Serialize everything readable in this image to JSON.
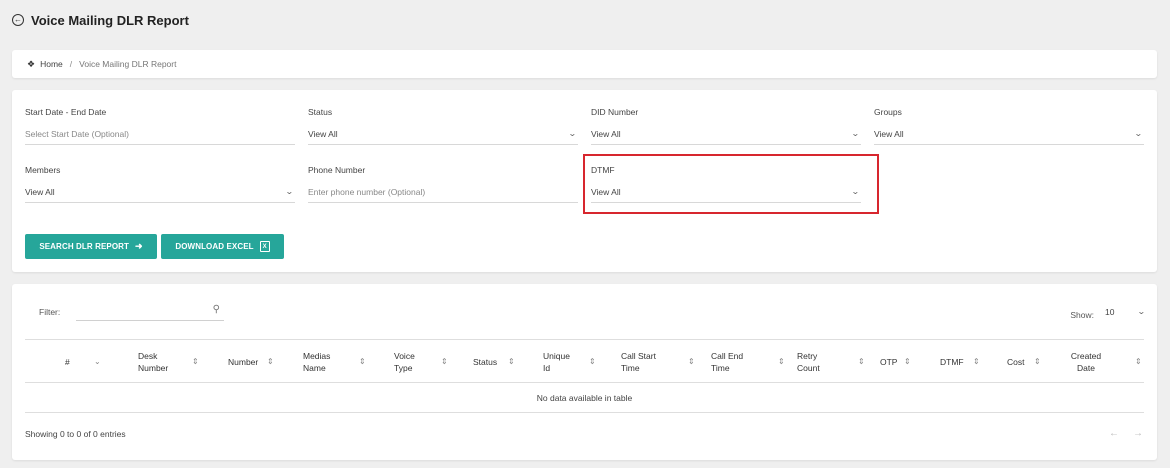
{
  "header": {
    "title": "Voice Mailing DLR Report"
  },
  "breadcrumb": {
    "home": "Home",
    "separator": "/",
    "current": "Voice Mailing DLR Report"
  },
  "filters": {
    "date_range": {
      "label": "Start Date - End Date",
      "placeholder": "Select Start Date (Optional)"
    },
    "status": {
      "label": "Status",
      "value": "View All"
    },
    "did_number": {
      "label": "DID Number",
      "value": "View All"
    },
    "groups": {
      "label": "Groups",
      "value": "View All"
    },
    "members": {
      "label": "Members",
      "value": "View All"
    },
    "phone_number": {
      "label": "Phone Number",
      "placeholder": "Enter phone number (Optional)"
    },
    "dtmf": {
      "label": "DTMF",
      "value": "View All"
    }
  },
  "buttons": {
    "search": "SEARCH DLR REPORT",
    "download": "DOWNLOAD EXCEL"
  },
  "table": {
    "filter_label": "Filter:",
    "show_label": "Show:",
    "page_size": "10",
    "columns": [
      "#",
      "Desk Number",
      "Number",
      "Medias Name",
      "Voice Type",
      "Status",
      "Unique Id",
      "Call Start Time",
      "Call End Time",
      "Retry Count",
      "OTP",
      "DTMF",
      "Cost",
      "Created Date"
    ],
    "empty_message": "No data available in table",
    "info": "Showing 0 to 0 of 0 entries"
  },
  "colors": {
    "accent": "#26a69a",
    "highlight": "#d7262e"
  }
}
